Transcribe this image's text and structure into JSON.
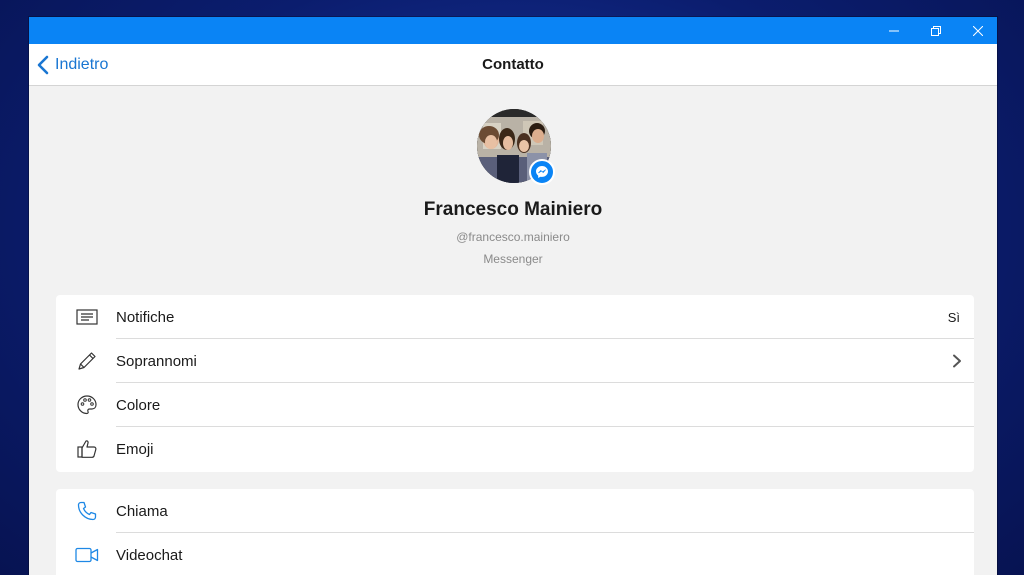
{
  "window": {
    "controls": {
      "minimize_icon": "minimize-icon",
      "restore_icon": "restore-icon",
      "close_icon": "close-icon"
    },
    "titlebar_color": "#0a84f5"
  },
  "appbar": {
    "back_label": "Indietro",
    "title": "Contatto",
    "accent_color": "#1976d2"
  },
  "profile": {
    "name": "Francesco Mainiero",
    "handle": "@francesco.mainiero",
    "source": "Messenger",
    "badge_icon": "messenger-icon"
  },
  "settings": [
    {
      "label": "Notifiche",
      "icon": "notification-icon",
      "value": "Sì"
    },
    {
      "label": "Soprannomi",
      "icon": "pencil-icon",
      "chevron": true
    },
    {
      "label": "Colore",
      "icon": "palette-icon"
    },
    {
      "label": "Emoji",
      "icon": "thumbs-up-icon"
    }
  ],
  "actions": [
    {
      "label": "Chiama",
      "icon": "phone-icon"
    },
    {
      "label": "Videochat",
      "icon": "video-camera-icon"
    }
  ]
}
